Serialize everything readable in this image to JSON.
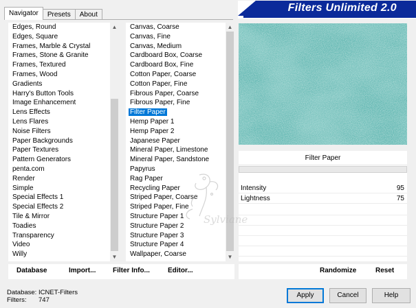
{
  "tabs": [
    {
      "label": "Navigator",
      "active": true
    },
    {
      "label": "Presets",
      "active": false
    },
    {
      "label": "About",
      "active": false
    }
  ],
  "banner": {
    "title": "Filters Unlimited 2.0"
  },
  "categories": {
    "items": [
      "Edges, Round",
      "Edges, Square",
      "Frames, Marble & Crystal",
      "Frames, Stone & Granite",
      "Frames, Textured",
      "Frames, Wood",
      "Gradients",
      "Harry's Button Tools",
      "Image Enhancement",
      "Lens Effects",
      "Lens Flares",
      "Noise Filters",
      "Paper Backgrounds",
      "Paper Textures",
      "Pattern Generators",
      "penta.com",
      "Render",
      "Simple",
      "Special Effects 1",
      "Special Effects 2",
      "Tile & Mirror",
      "Toadies",
      "Transparency",
      "Video",
      "Willy"
    ]
  },
  "filters": {
    "items": [
      "Canvas, Coarse",
      "Canvas, Fine",
      "Canvas, Medium",
      "Cardboard Box, Coarse",
      "Cardboard Box, Fine",
      "Cotton Paper, Coarse",
      "Cotton Paper, Fine",
      "Fibrous Paper, Coarse",
      "Fibrous Paper, Fine",
      "Filter Paper",
      "Hemp Paper 1",
      "Hemp Paper 2",
      "Japanese Paper",
      "Mineral Paper, Limestone",
      "Mineral Paper, Sandstone",
      "Papyrus",
      "Rag Paper",
      "Recycling Paper",
      "Striped Paper, Coarse",
      "Striped Paper, Fine",
      "Structure Paper 1",
      "Structure Paper 2",
      "Structure Paper 3",
      "Structure Paper 4",
      "Wallpaper, Coarse"
    ],
    "selected": "Filter Paper"
  },
  "preview": {
    "colors": {
      "base": "#5fb8b2",
      "dark": "#3e9690",
      "light": "#86d0cb"
    }
  },
  "current_filter": "Filter Paper",
  "params": [
    {
      "name": "Intensity",
      "value": "95"
    },
    {
      "name": "Lightness",
      "value": "75"
    }
  ],
  "toolbar": {
    "database": "Database",
    "import": "Import...",
    "filter_info": "Filter Info...",
    "editor": "Editor...",
    "randomize": "Randomize",
    "reset": "Reset"
  },
  "info": {
    "database_label": "Database:",
    "database_value": "ICNET-Filters",
    "filters_label": "Filters:",
    "filters_value": "747"
  },
  "buttons": {
    "apply": "Apply",
    "cancel": "Cancel",
    "help": "Help"
  },
  "watermark": {
    "text": "Sylviane"
  }
}
